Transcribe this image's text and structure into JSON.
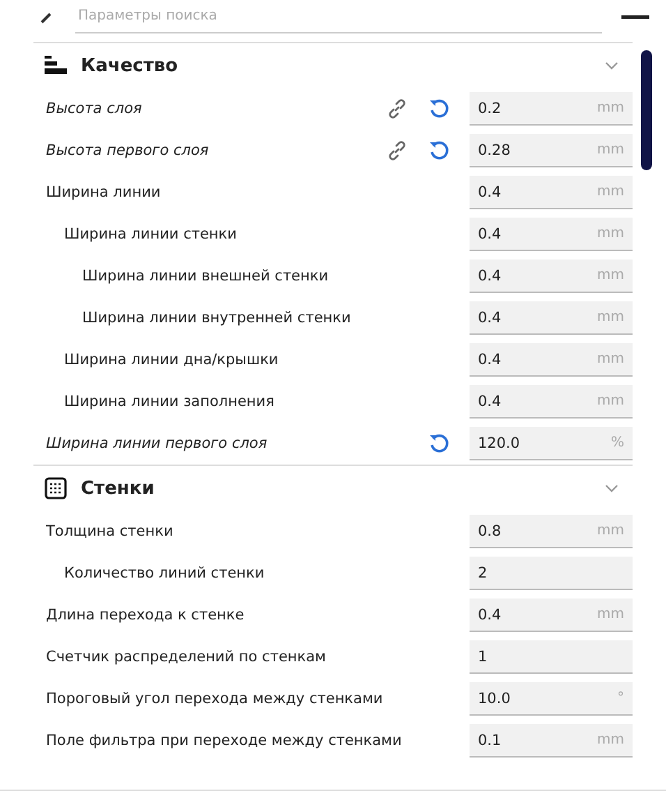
{
  "search": {
    "placeholder": "Параметры поиска"
  },
  "sections": [
    {
      "title": "Качество",
      "expanded": true,
      "settings": [
        {
          "label": "Высота слоя",
          "modified": true,
          "linked": true,
          "resettable": true,
          "value": "0.2",
          "unit": "mm"
        },
        {
          "label": "Высота первого слоя",
          "modified": true,
          "linked": true,
          "resettable": true,
          "value": "0.28",
          "unit": "mm"
        },
        {
          "label": "Ширина линии",
          "modified": false,
          "linked": false,
          "resettable": false,
          "value": "0.4",
          "unit": "mm",
          "children": [
            {
              "label": "Ширина линии стенки",
              "modified": false,
              "linked": false,
              "resettable": false,
              "value": "0.4",
              "unit": "mm",
              "children": [
                {
                  "label": "Ширина линии внешней стенки",
                  "modified": false,
                  "linked": false,
                  "resettable": false,
                  "value": "0.4",
                  "unit": "mm"
                },
                {
                  "label": "Ширина линии внутренней стенки",
                  "modified": false,
                  "linked": false,
                  "resettable": false,
                  "value": "0.4",
                  "unit": "mm"
                }
              ]
            },
            {
              "label": "Ширина линии дна/крышки",
              "modified": false,
              "linked": false,
              "resettable": false,
              "value": "0.4",
              "unit": "mm"
            },
            {
              "label": "Ширина линии заполнения",
              "modified": false,
              "linked": false,
              "resettable": false,
              "value": "0.4",
              "unit": "mm"
            }
          ]
        },
        {
          "label": "Ширина линии первого слоя",
          "modified": true,
          "linked": false,
          "resettable": true,
          "value": "120.0",
          "unit": "%"
        }
      ]
    },
    {
      "title": "Стенки",
      "expanded": true,
      "settings": [
        {
          "label": "Толщина стенки",
          "modified": false,
          "linked": false,
          "resettable": false,
          "value": "0.8",
          "unit": "mm",
          "children": [
            {
              "label": "Количество линий стенки",
              "modified": false,
              "linked": false,
              "resettable": false,
              "value": "2"
            }
          ]
        },
        {
          "label": "Длина перехода к стенке",
          "modified": false,
          "linked": false,
          "resettable": false,
          "value": "0.4",
          "unit": "mm"
        },
        {
          "label": "Счетчик распределений по стенкам",
          "modified": false,
          "linked": false,
          "resettable": false,
          "value": "1"
        },
        {
          "label": "Пороговый угол перехода между стенками",
          "modified": false,
          "linked": false,
          "resettable": false,
          "value": "10.0",
          "unit": "°"
        },
        {
          "label": "Поле фильтра при переходе между стенками",
          "modified": false,
          "linked": false,
          "resettable": false,
          "value": "0.1",
          "unit": "mm"
        }
      ]
    }
  ]
}
